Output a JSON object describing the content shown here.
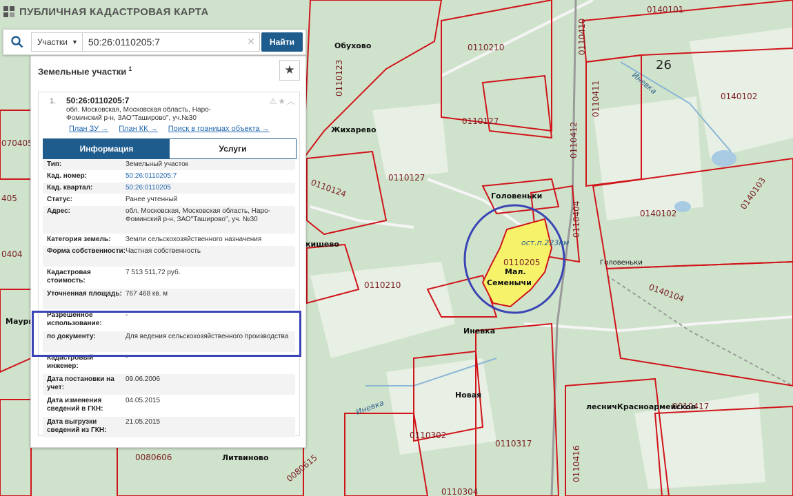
{
  "app": {
    "title": "ПУБЛИЧНАЯ КАДАСТРОВАЯ КАРТА"
  },
  "search": {
    "type_label": "Участки",
    "query": "50:26:0110205:7",
    "find_label": "Найти"
  },
  "panel": {
    "title": "Земельные участки",
    "count_sup": "1",
    "result": {
      "index": "1.",
      "cad_number": "50:26:0110205:7",
      "address": "обл. Московская, Московская область, Наро-Фоминский р-н, ЗАО\"Таширово\", уч.№30",
      "links": [
        "План ЗУ →",
        "План КК →",
        "Поиск в границах объекта →"
      ],
      "tabs": [
        "Информация",
        "Услуги"
      ],
      "rows": [
        {
          "label": "Тип:",
          "value": "Земельный участок"
        },
        {
          "label": "Кад. номер:",
          "value": "50:26:0110205:7"
        },
        {
          "label": "Кад. квартал:",
          "value": "50:26:0110205"
        },
        {
          "label": "Статус:",
          "value": "Ранее учтенный"
        },
        {
          "label": "Адрес:",
          "value": "обл. Московская, Московская область, Наро-Фоминский р-н, ЗАО\"Таширово\", уч. №30"
        },
        {
          "label": "Категория земель:",
          "value": "Земли сельскохозяйственного назначения"
        },
        {
          "label": "Форма собственности:",
          "value": "Частная собственность"
        },
        {
          "label": "Кадастровая стоимость:",
          "value": "7 513 511,72 руб."
        },
        {
          "label": "Уточненная площадь:",
          "value": "767 468 кв. м"
        },
        {
          "label": "Разрешенное использование:",
          "value": "-"
        },
        {
          "label": "по документу:",
          "value": "Для ведения сельскохозяйственного производства"
        },
        {
          "label": "Кадастровый инженер:",
          "value": "-"
        },
        {
          "label": "Дата постановки на учет:",
          "value": "09.06.2006"
        },
        {
          "label": "Дата изменения сведений в ГКН:",
          "value": "04.05.2015"
        },
        {
          "label": "Дата выгрузки сведений из ГКН:",
          "value": "21.05.2015"
        }
      ]
    }
  },
  "map": {
    "quarter_labels": [
      "0140101",
      "0110210",
      "0110127",
      "0110127",
      "0140102",
      "0140102",
      "0110124",
      "0110205",
      "0110210",
      "0140104",
      "0110317",
      "0110302",
      "0080606",
      "0110416",
      "0110412",
      "0110404",
      "0110411",
      "0110410",
      "0140103",
      "0110304",
      "0010417",
      "070405",
      "405",
      "0404",
      "0080615",
      "0110123"
    ],
    "district_label": "26",
    "place_labels": [
      "Обухово",
      "Жихарево",
      "Головеньки",
      "Мал.",
      "Семенычи",
      "Иневка",
      "Новая",
      "Литвиново",
      "лесничКрасноармейское",
      "Маури",
      "якишево",
      "Головеньки"
    ],
    "river_labels": [
      "Иневка",
      "Иневка"
    ],
    "stop_label": "ост.п.223км",
    "colors": {
      "parcel_border": "#d0141a",
      "parcel_highlight": "#f6f36a",
      "circle": "#3a44b4",
      "forest": "#cfe3cc"
    }
  }
}
